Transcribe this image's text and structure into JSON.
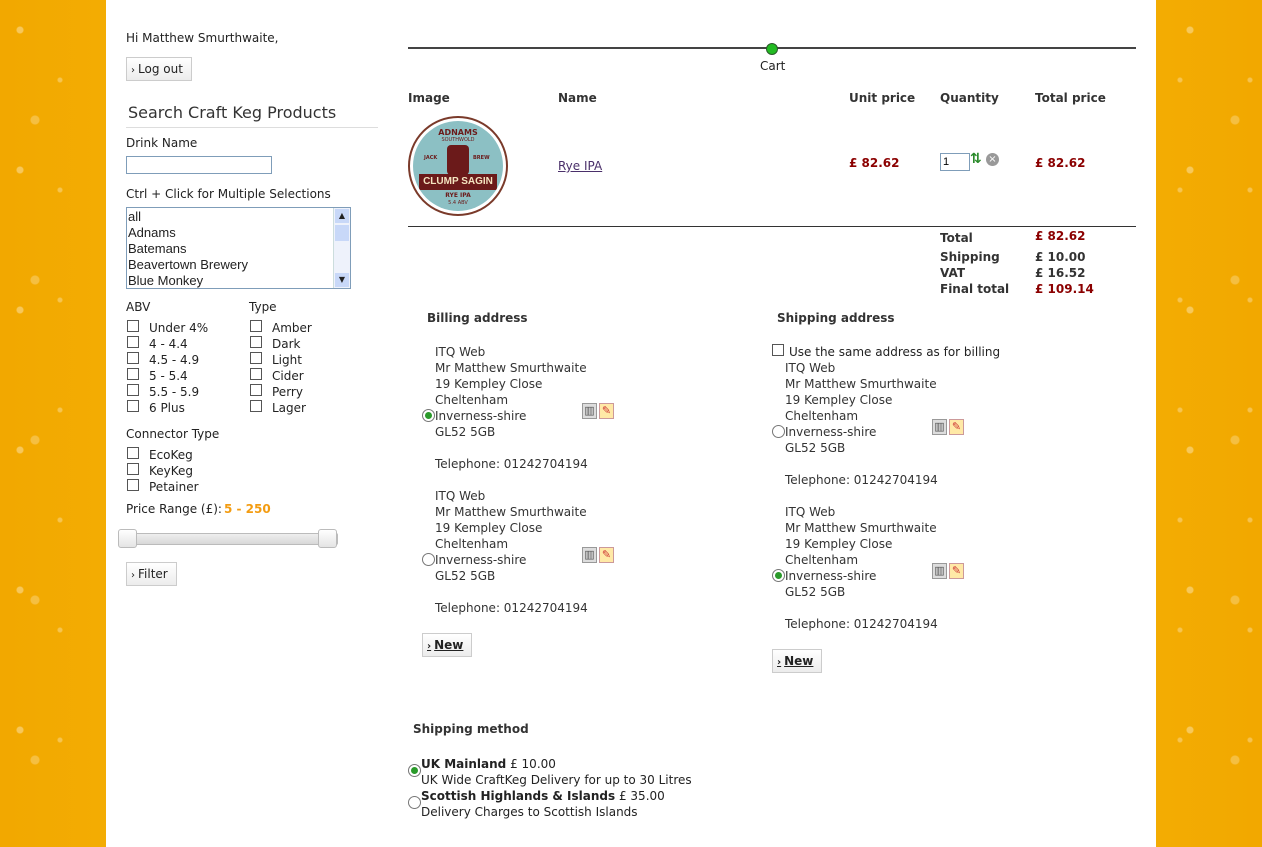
{
  "greeting": "Hi Matthew Smurthwaite,",
  "logout_label": "Log out",
  "search": {
    "title": "Search Craft Keg Products",
    "drink_name_label": "Drink Name",
    "drink_name_value": "",
    "multi_hint": "Ctrl + Click for Multiple Selections",
    "breweries": [
      "all",
      "Adnams",
      "Batemans",
      "Beavertown Brewery",
      "Blue Monkey"
    ],
    "abv_label": "ABV",
    "abv_options": [
      "Under 4%",
      "4 - 4.4",
      "4.5 - 4.9",
      "5 - 5.4",
      "5.5 - 5.9",
      "6 Plus"
    ],
    "type_label": "Type",
    "type_options": [
      "Amber",
      "Dark",
      "Light",
      "Cider",
      "Perry",
      "Lager"
    ],
    "connector_label": "Connector Type",
    "connector_options": [
      "EcoKeg",
      "KeyKeg",
      "Petainer"
    ],
    "price_label": "Price Range (£):",
    "price_value": "5 - 250",
    "filter_label": "Filter"
  },
  "progress": {
    "step_label": "Cart"
  },
  "cart": {
    "headers": {
      "image": "Image",
      "name": "Name",
      "unit_price": "Unit price",
      "quantity": "Quantity",
      "total_price": "Total price"
    },
    "item": {
      "name": "Rye IPA",
      "unit_price": "£ 82.62",
      "quantity": "1",
      "total_price": "£ 82.62",
      "badge_top": "ADNAMS",
      "badge_sub": "SOUTHWOLD",
      "badge_jack": "JACK",
      "badge_brew": "BREW",
      "badge_main": "CLUMP SAGIN",
      "badge_bottom": "RYE IPA",
      "badge_abv": "5.4 ABV"
    },
    "totals": {
      "total_label": "Total",
      "total_value": "£ 82.62",
      "shipping_label": "Shipping",
      "shipping_value": "£ 10.00",
      "vat_label": "VAT",
      "vat_value": "£ 16.52",
      "final_label": "Final total",
      "final_value": "£ 109.14"
    }
  },
  "billing": {
    "title": "Billing address",
    "addresses": [
      {
        "company": "ITQ Web",
        "name": "Mr Matthew Smurthwaite",
        "street": "19 Kempley Close",
        "city": "Cheltenham",
        "county": "Inverness-shire",
        "postcode": "GL52 5GB",
        "phone": "Telephone: 01242704194"
      },
      {
        "company": "ITQ Web",
        "name": "Mr Matthew Smurthwaite",
        "street": "19 Kempley Close",
        "city": "Cheltenham",
        "county": "Inverness-shire",
        "postcode": "GL52 5GB",
        "phone": "Telephone: 01242704194"
      }
    ],
    "new_label": "New"
  },
  "shipping_addr": {
    "title": "Shipping address",
    "same_label": "Use the same address as for billing",
    "addresses": [
      {
        "company": "ITQ Web",
        "name": "Mr Matthew Smurthwaite",
        "street": "19 Kempley Close",
        "city": "Cheltenham",
        "county": "Inverness-shire",
        "postcode": "GL52 5GB",
        "phone": "Telephone: 01242704194"
      },
      {
        "company": "ITQ Web",
        "name": "Mr Matthew Smurthwaite",
        "street": "19 Kempley Close",
        "city": "Cheltenham",
        "county": "Inverness-shire",
        "postcode": "GL52 5GB",
        "phone": "Telephone: 01242704194"
      }
    ],
    "new_label": "New"
  },
  "shipping_method": {
    "title": "Shipping method",
    "options": [
      {
        "name": "UK Mainland",
        "price": "£ 10.00",
        "desc": "UK Wide CraftKeg Delivery for up to 30 Litres"
      },
      {
        "name": "Scottish Highlands & Islands",
        "price": "£ 35.00",
        "desc": "Delivery Charges to Scottish Islands"
      }
    ]
  },
  "icons": {
    "refresh": "refresh-icon",
    "remove": "remove-icon",
    "trash": "trash-icon",
    "edit": "edit-icon",
    "arrow": "chevron-right-icon"
  },
  "colors": {
    "price_red": "#8b0000",
    "accent_orange": "#f39c12",
    "progress_green": "#22bb22"
  }
}
